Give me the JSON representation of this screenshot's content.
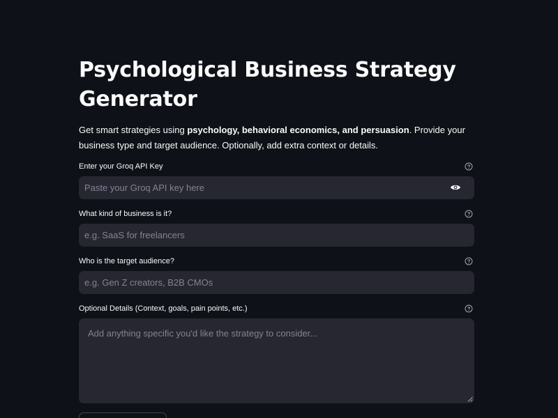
{
  "header": {
    "title_line1": "Psychological Business Strategy",
    "title_line2": "Generator"
  },
  "description": {
    "part1": "Get smart strategies using ",
    "bold": "psychology, behavioral economics, and persuasion",
    "part2": ". Provide your business type and target audience. Optionally, add extra context or details."
  },
  "fields": {
    "api_key": {
      "label": "Enter your Groq API Key",
      "placeholder": "Paste your Groq API key here",
      "icon": "eye-icon"
    },
    "business": {
      "label": "What kind of business is it?",
      "placeholder": "e.g. SaaS for freelancers"
    },
    "audience": {
      "label": "Who is the target audience?",
      "placeholder": "e.g. Gen Z creators, B2B CMOs"
    },
    "details": {
      "label": "Optional Details (Context, goals, pain points, etc.)",
      "placeholder": "Add anything specific you'd like the strategy to consider..."
    }
  },
  "icons": {
    "help": "question-circle-icon"
  },
  "colors": {
    "background": "#0e1117",
    "input_background": "#262730",
    "text": "#fafafa",
    "placeholder": "#808495"
  }
}
